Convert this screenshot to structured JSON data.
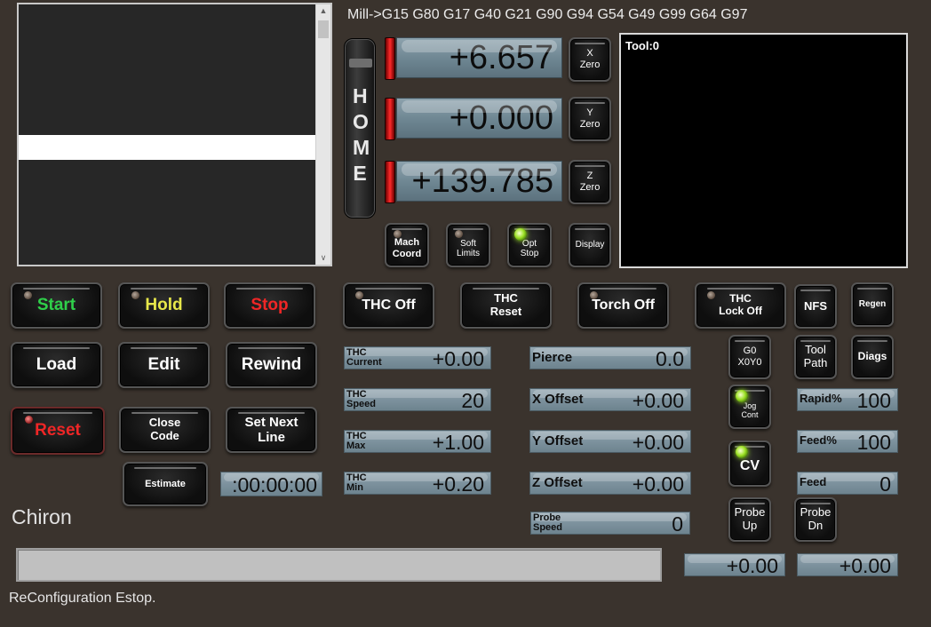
{
  "modal_line": "Mill->G15  G80 G17 G40 G21 G90 G94 G54 G49 G99 G64 G97",
  "home_label": "HOME",
  "dro": {
    "x": "+6.657",
    "y": "+0.000",
    "z": "+139.785"
  },
  "axis_zero": {
    "x": "X\nZero",
    "y": "Y\nZero",
    "z": "Z\nZero"
  },
  "small_buttons": {
    "mach_coord": "Mach\nCoord",
    "soft_limits": "Soft\nLimits",
    "opt_stop": "Opt\nStop",
    "display": "Display"
  },
  "tool_display": "Tool:0",
  "main_buttons": {
    "start": "Start",
    "hold": "Hold",
    "stop": "Stop",
    "load": "Load",
    "edit": "Edit",
    "rewind": "Rewind",
    "reset": "Reset",
    "close_code": "Close\nCode",
    "set_next_line": "Set Next\nLine",
    "estimate": "Estimate"
  },
  "thc_buttons": {
    "thc_off": "THC Off",
    "thc_reset": "THC\nReset",
    "torch_off": "Torch Off",
    "thc_lock_off": "THC\nLock Off",
    "nfs": "NFS",
    "regen": "Regen",
    "g0_x0y0": "G0\nX0Y0",
    "tool_path": "Tool\nPath",
    "diags": "Diags",
    "jog_cont": "Jog\nCont",
    "cv": "CV",
    "probe_up": "Probe\nUp",
    "probe_dn": "Probe\nDn"
  },
  "timer": ":00:00:00",
  "thc_fields": [
    {
      "label": "THC\nCurrent",
      "value": "+0.00"
    },
    {
      "label": "THC\nSpeed",
      "value": "20"
    },
    {
      "label": "THC\nMax",
      "value": "+1.00"
    },
    {
      "label": "THC\nMin",
      "value": "+0.20"
    }
  ],
  "offset_fields": [
    {
      "label": "Pierce",
      "value": "0.0"
    },
    {
      "label": "X Offset",
      "value": "+0.00"
    },
    {
      "label": "Y Offset",
      "value": "+0.00"
    },
    {
      "label": "Z Offset",
      "value": "+0.00"
    },
    {
      "label": "Probe\nSpeed",
      "value": "0"
    }
  ],
  "rate_fields": [
    {
      "label": "Rapid%",
      "value": "100"
    },
    {
      "label": "Feed%",
      "value": "100"
    },
    {
      "label": "Feed",
      "value": "0"
    }
  ],
  "bottom_values": [
    "+0.00",
    "+0.00"
  ],
  "machine_name": "Chiron",
  "status_message": "ReConfiguration Estop."
}
